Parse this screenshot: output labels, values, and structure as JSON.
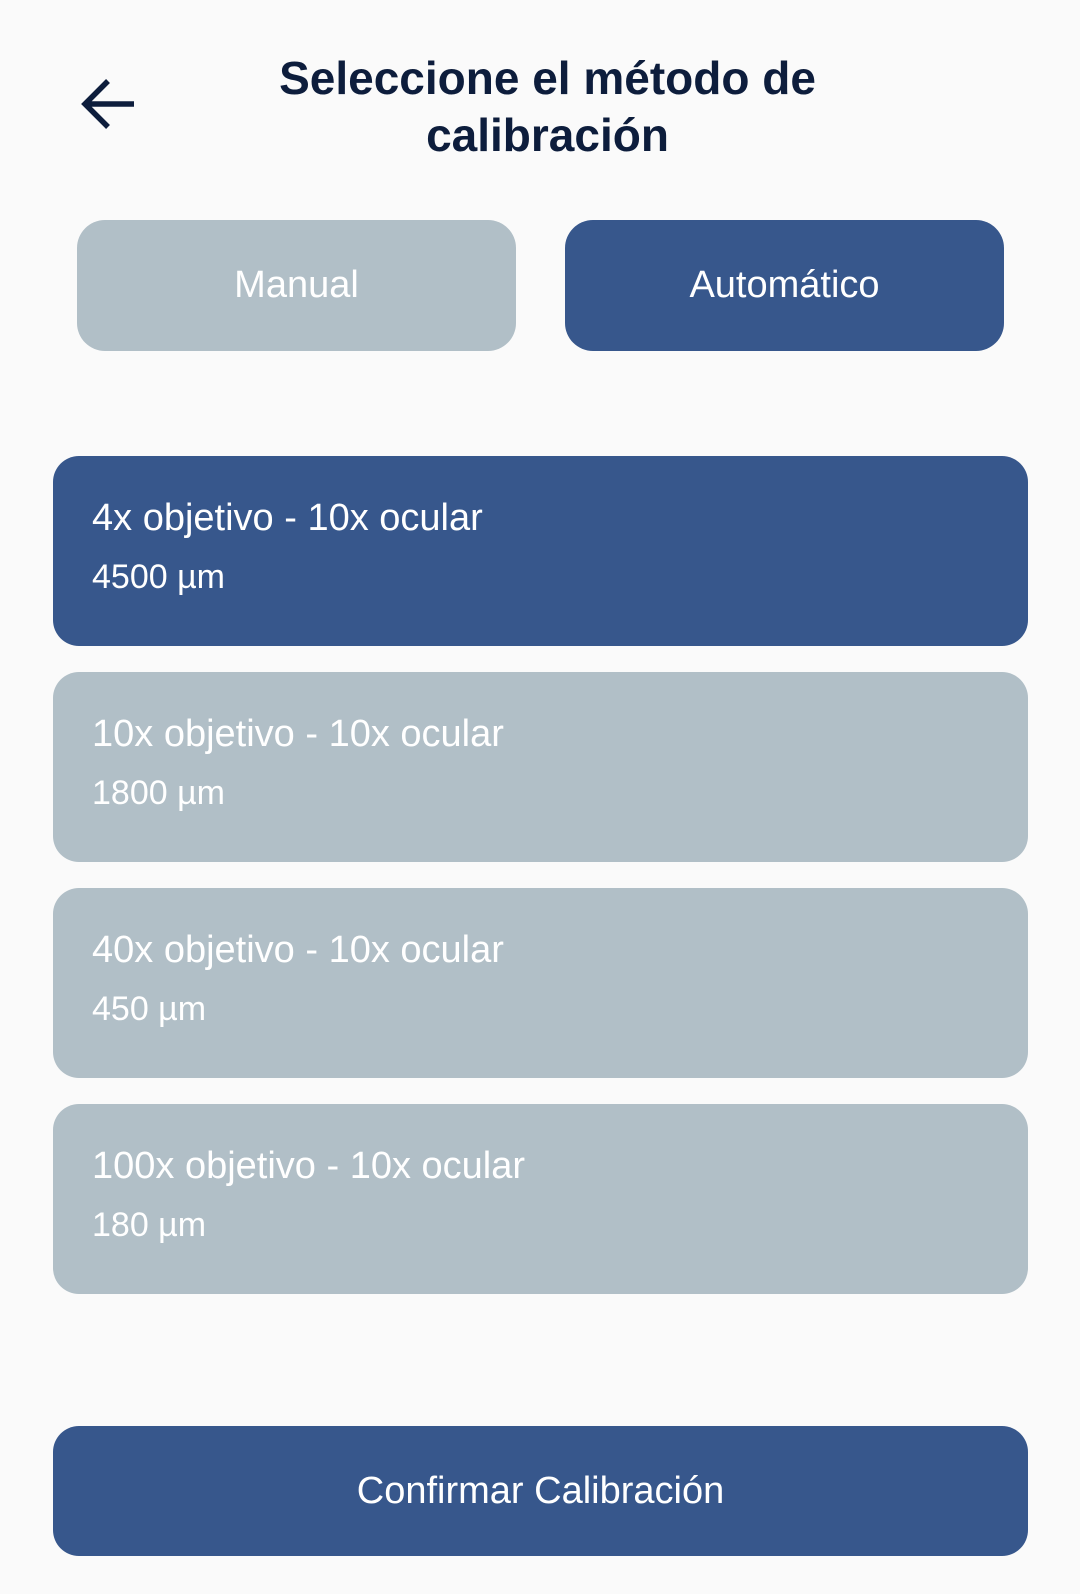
{
  "header": {
    "back_icon": "arrow-left-icon",
    "title": "Seleccione el método de calibración"
  },
  "method_toggle": {
    "options": [
      {
        "label": "Manual",
        "selected": false
      },
      {
        "label": "Automático",
        "selected": true
      }
    ]
  },
  "calibration_options": [
    {
      "title": "4x objetivo - 10x ocular",
      "value": "4500 µm",
      "selected": true
    },
    {
      "title": "10x objetivo - 10x ocular",
      "value": "1800 µm",
      "selected": false
    },
    {
      "title": "40x objetivo - 10x ocular",
      "value": "450 µm",
      "selected": false
    },
    {
      "title": "100x objetivo - 10x ocular",
      "value": "180 µm",
      "selected": false
    }
  ],
  "footer": {
    "confirm_label": "Confirmar Calibración"
  },
  "colors": {
    "primary": "#37578c",
    "inactive": "#b1bfc7",
    "title_text": "#0d1d3c",
    "background": "#fafafa"
  }
}
